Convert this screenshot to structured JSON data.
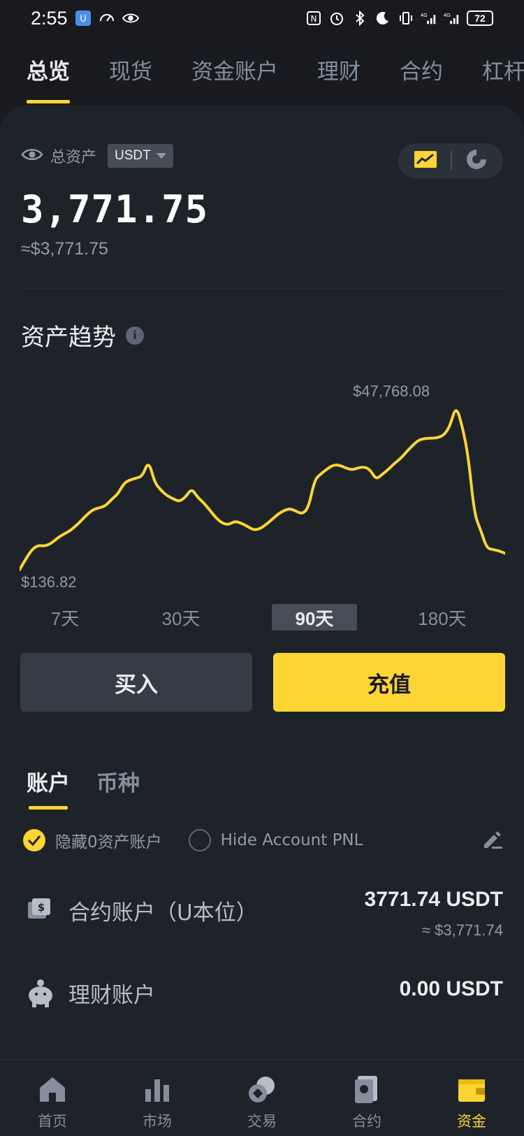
{
  "status_bar": {
    "time": "2:55",
    "battery": "72",
    "network": "4G"
  },
  "top_tabs": [
    "总览",
    "现货",
    "资金账户",
    "理财",
    "合约",
    "杠杆"
  ],
  "summary": {
    "assets_label": "总资产",
    "currency": "USDT",
    "balance": "3,771.75",
    "balance_fiat": "≈$3,771.75"
  },
  "trend": {
    "title": "资产趋势",
    "max_label": "$47,768.08",
    "min_label": "$136.82"
  },
  "chart_data": {
    "type": "line",
    "series": [
      {
        "values": [
          136.82,
          3200,
          6000,
          7200,
          7000,
          7600,
          9100,
          10300,
          11200,
          12600,
          14300,
          16200,
          17600,
          18100,
          18700,
          20600,
          22100,
          25300,
          26200,
          26700,
          27300,
          31800,
          25400,
          23200,
          21600,
          20700,
          19900,
          21200,
          23700,
          21100,
          19500,
          17300,
          15100,
          13600,
          13200,
          14200,
          13700,
          12800,
          11700,
          11900,
          13100,
          14600,
          16200,
          17300,
          17900,
          17100,
          16300,
          18100,
          26200,
          27900,
          29300,
          30500,
          30500,
          29700,
          29100,
          29600,
          30000,
          29200,
          26300,
          27800,
          29200,
          31000,
          32400,
          34400,
          36300,
          37800,
          38200,
          38300,
          38400,
          39100,
          41600,
          47768.08,
          42000,
          33200,
          16200,
          11800,
          6400,
          6000,
          5600,
          4900
        ]
      }
    ],
    "ranges": [
      "7天",
      "30天",
      "90天",
      "180天"
    ],
    "selected_range": "90天",
    "grid": false,
    "line_color": "#fcd535"
  },
  "actions": {
    "buy": "买入",
    "deposit": "充值"
  },
  "subtabs": [
    "账户",
    "币种"
  ],
  "filters": {
    "hide_zero": "隐藏0资产账户",
    "hide_pnl": "Hide Account PNL"
  },
  "accounts": [
    {
      "name": "合约账户（U本位）",
      "value": "3771.74 USDT",
      "fiat": "≈ $3,771.74",
      "icon": "futures-account-icon"
    },
    {
      "name": "理财账户",
      "value": "0.00 USDT",
      "icon": "earn-piggy-icon"
    }
  ],
  "bottom_nav": [
    {
      "label": "首页",
      "icon": "home-icon"
    },
    {
      "label": "市场",
      "icon": "market-bars-icon"
    },
    {
      "label": "交易",
      "icon": "trade-coins-icon"
    },
    {
      "label": "合约",
      "icon": "futures-icon"
    },
    {
      "label": "资金",
      "icon": "wallet-icon"
    }
  ],
  "colors": {
    "accent": "#fcd535",
    "background": "#181a20",
    "panel": "#1e2329"
  }
}
